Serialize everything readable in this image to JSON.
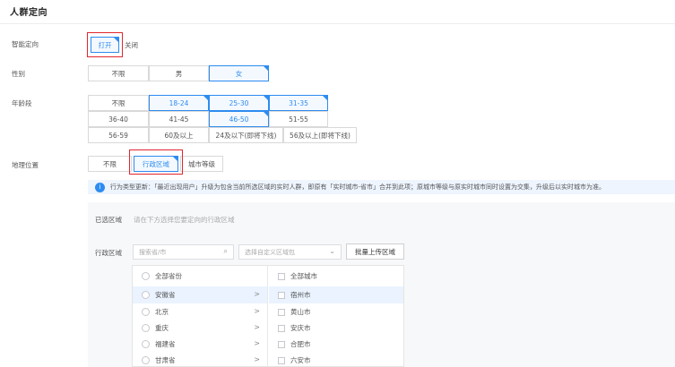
{
  "header": {
    "title": "人群定向"
  },
  "smart": {
    "label": "智能定向",
    "on": "打开",
    "off": "关闭"
  },
  "gender": {
    "label": "性别",
    "options": [
      "不限",
      "男",
      "女"
    ]
  },
  "age": {
    "label": "年龄段",
    "options": [
      "不限",
      "18-24",
      "25-30",
      "31-35",
      "36-40",
      "41-45",
      "46-50",
      "51-55",
      "56-59",
      "60及以上",
      "24及以下(即将下线)",
      "56及以上(即将下线)"
    ]
  },
  "location": {
    "label": "地理位置",
    "options": [
      "不限",
      "行政区域",
      "城市等级"
    ]
  },
  "notice": {
    "text": "行为类型更新：「最近出现用户」升级为包含当前所选区域的实时人群，即原有「实时城市-省市」合并到此项；原城市等级与原实时城市同时设置为交集，升级后以实时城市为准。"
  },
  "selected": {
    "label": "已选区域",
    "placeholder": "请在下方选择您要定向的行政区域"
  },
  "admin": {
    "label": "行政区域",
    "search_placeholder": "搜索省/市",
    "custom_placeholder": "选择自定义区域包",
    "upload_label": "批量上传区域"
  },
  "provinces": {
    "all": "全部省份",
    "items": [
      "安徽省",
      "北京",
      "重庆",
      "福建省",
      "甘肃省"
    ],
    "arrow": ">"
  },
  "cities": {
    "all": "全部城市",
    "items": [
      "宿州市",
      "黄山市",
      "安庆市",
      "合肥市",
      "六安市"
    ]
  },
  "icons": {
    "search": "search-icon",
    "dropdown": "chevron-down-icon",
    "info": "info-icon"
  },
  "colors": {
    "accent": "#2d8cf0",
    "highlight": "#e0262f"
  }
}
